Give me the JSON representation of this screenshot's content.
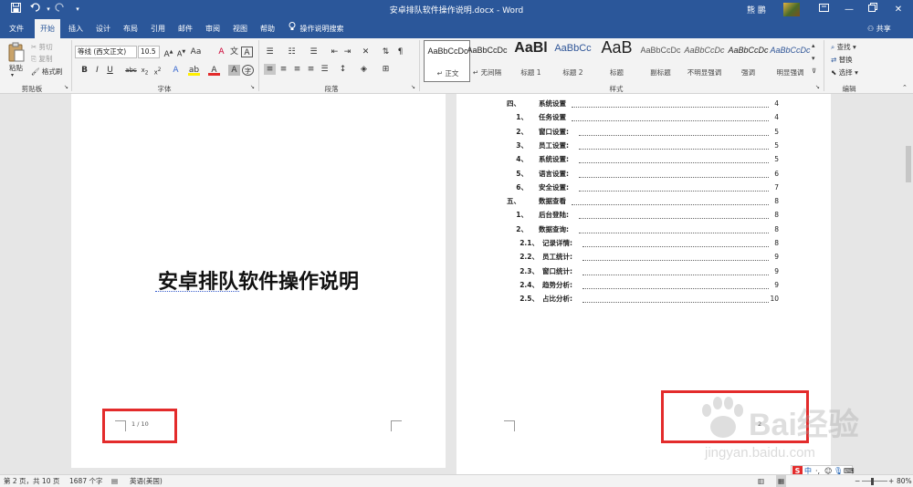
{
  "titlebar": {
    "document_title": "安卓排队软件操作说明.docx - Word",
    "user_name": "熊 鹏",
    "save_icon": "save-icon",
    "undo_icon": "undo-icon",
    "redo_icon": "redo-icon",
    "customize_icon": "customize-qat-icon"
  },
  "tabs": [
    "文件",
    "开始",
    "插入",
    "设计",
    "布局",
    "引用",
    "邮件",
    "审阅",
    "视图",
    "帮助"
  ],
  "active_tab": "开始",
  "help_search": "操作说明搜索",
  "share_label": "共享",
  "ribbon": {
    "clipboard": {
      "paste": "粘贴",
      "cut": "剪切",
      "copy": "复制",
      "format_painter": "格式刷",
      "label": "剪贴板"
    },
    "font": {
      "font_name": "等线 (西文正文)",
      "font_size": "10.5",
      "label": "字体"
    },
    "paragraph": {
      "label": "段落"
    },
    "styles": {
      "label": "样式",
      "items": [
        {
          "sample": "AaBbCcDc",
          "name": "正文"
        },
        {
          "sample": "AaBbCcDc",
          "name": "无间隔"
        },
        {
          "sample": "AaBl",
          "name": "标题 1"
        },
        {
          "sample": "AaBbCc",
          "name": "标题 2"
        },
        {
          "sample": "AaB",
          "name": "标题"
        },
        {
          "sample": "AaBbCcDc",
          "name": "副标题"
        },
        {
          "sample": "AaBbCcDc",
          "name": "不明显强调"
        },
        {
          "sample": "AaBbCcDc",
          "name": "强调"
        },
        {
          "sample": "AaBbCcDc",
          "name": "明显强调"
        }
      ]
    },
    "editing": {
      "find": "查找",
      "replace": "替换",
      "select": "选择",
      "label": "编辑"
    }
  },
  "document": {
    "title": "安卓排队软件操作说明",
    "page1_number": "1 / 10",
    "page2_number": "2",
    "toc": [
      {
        "num": "四、",
        "text": "系统设置",
        "page": "4",
        "level": 1
      },
      {
        "num": "1、",
        "text": "任务设置",
        "page": "4",
        "level": 2
      },
      {
        "num": "2、",
        "text": "窗口设置:",
        "page": "5",
        "level": 2
      },
      {
        "num": "3、",
        "text": "员工设置:",
        "page": "5",
        "level": 2
      },
      {
        "num": "4、",
        "text": "系统设置:",
        "page": "5",
        "level": 2
      },
      {
        "num": "5、",
        "text": "语言设置:",
        "page": "6",
        "level": 2
      },
      {
        "num": "6、",
        "text": "安全设置:",
        "page": "7",
        "level": 2
      },
      {
        "num": "五、",
        "text": "数据查看",
        "page": "8",
        "level": 1
      },
      {
        "num": "1、",
        "text": "后台登陆:",
        "page": "8",
        "level": 2
      },
      {
        "num": "2、",
        "text": "数据查询:",
        "page": "8",
        "level": 2
      },
      {
        "num": "2.1、",
        "text": "记录详情:",
        "page": "8",
        "level": 3
      },
      {
        "num": "2.2、",
        "text": "员工统计:",
        "page": "9",
        "level": 3
      },
      {
        "num": "2.3、",
        "text": "窗口统计:",
        "page": "9",
        "level": 3
      },
      {
        "num": "2.4、",
        "text": "趋势分析:",
        "page": "9",
        "level": 3
      },
      {
        "num": "2.5、",
        "text": "占比分析:",
        "page": "10",
        "level": 3
      }
    ]
  },
  "statusbar": {
    "page_info": "第 2 页，共 10 页",
    "word_count": "1687 个字",
    "language": "英语(美国)",
    "zoom": "80%"
  },
  "watermark": {
    "brand": "Bai经验",
    "url": "jingyan.baidu.com"
  },
  "ime": {
    "label": "中"
  },
  "colors": {
    "titlebar": "#2b579a",
    "highlight_box": "#e32b2b"
  }
}
